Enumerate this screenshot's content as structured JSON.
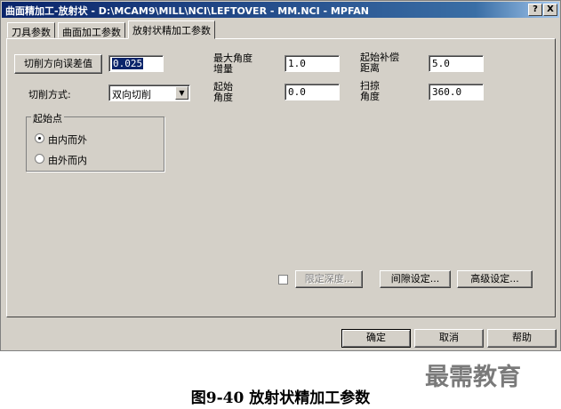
{
  "window": {
    "title": "曲面精加工-放射状 - D:\\MCAM9\\MILL\\NCI\\LEFTOVER - MM.NCI - MPFAN",
    "help_label": "?",
    "close_label": "X"
  },
  "tabs": [
    {
      "label": "刀具参数"
    },
    {
      "label": "曲面加工参数"
    },
    {
      "label": "放射状精加工参数"
    }
  ],
  "params": {
    "cut_tolerance_button": "切削方向误差值",
    "cut_tolerance_value": "0.025",
    "cut_method_label": "切削方式:",
    "cut_method_value": "双向切削",
    "max_angle_inc_label": [
      "最大角度",
      "增量"
    ],
    "max_angle_inc_value": "1.0",
    "start_comp_dist_label": [
      "起始补偿",
      "距离"
    ],
    "start_comp_dist_value": "5.0",
    "start_angle_label": [
      "起始",
      "角度"
    ],
    "start_angle_value": "0.0",
    "sweep_angle_label": [
      "扫掠",
      "角度"
    ],
    "sweep_angle_value": "360.0"
  },
  "start_point": {
    "title": "起始点",
    "options": [
      {
        "label": "由内而外",
        "selected": true
      },
      {
        "label": "由外而内",
        "selected": false
      }
    ]
  },
  "panel_buttons": {
    "limit_depth": "限定深度...",
    "gap_settings": "间隙设定...",
    "advanced_settings": "高级设定..."
  },
  "footer": {
    "ok": "确定",
    "cancel": "取消",
    "help": "帮助"
  },
  "watermark": "最需教育",
  "caption": "图9-40 放射状精加工参数"
}
